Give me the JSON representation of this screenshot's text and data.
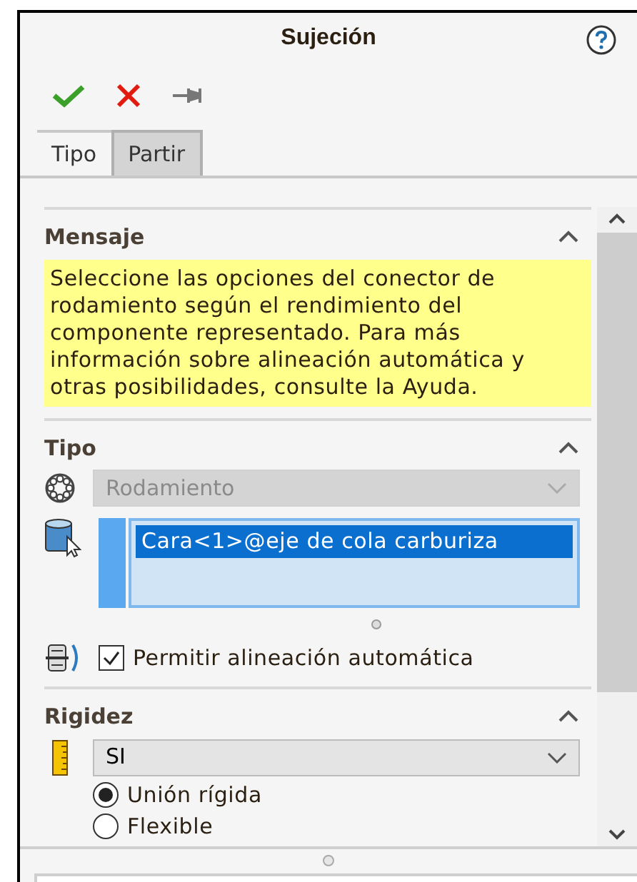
{
  "window": {
    "title": "Sujeción"
  },
  "tabs": [
    {
      "label": "Tipo",
      "selected": true
    },
    {
      "label": "Partir",
      "selected": false
    }
  ],
  "sections": [
    {
      "kind": "message",
      "title": "Mensaje",
      "expanded": true,
      "text": "Seleccione las opciones del conector de rodamiento según el rendimiento del componente representado. Para más información sobre alineación automática y otras posibilidades, consulte la Ayuda."
    },
    {
      "kind": "type",
      "title": "Tipo",
      "expanded": true,
      "select": {
        "value": "Rodamiento",
        "disabled": true
      },
      "selection": [
        {
          "label": "Cara<1>@eje de cola carburiza",
          "selected": true
        }
      ],
      "checkbox": {
        "label": "Permitir alineación automática",
        "checked": true
      }
    },
    {
      "kind": "rigidity",
      "title": "Rigidez",
      "expanded": true,
      "select": {
        "value": "SI",
        "disabled": false
      },
      "radios": [
        {
          "label": "Unión rígida",
          "selected": true
        },
        {
          "label": "Flexible",
          "selected": false
        }
      ]
    }
  ]
}
